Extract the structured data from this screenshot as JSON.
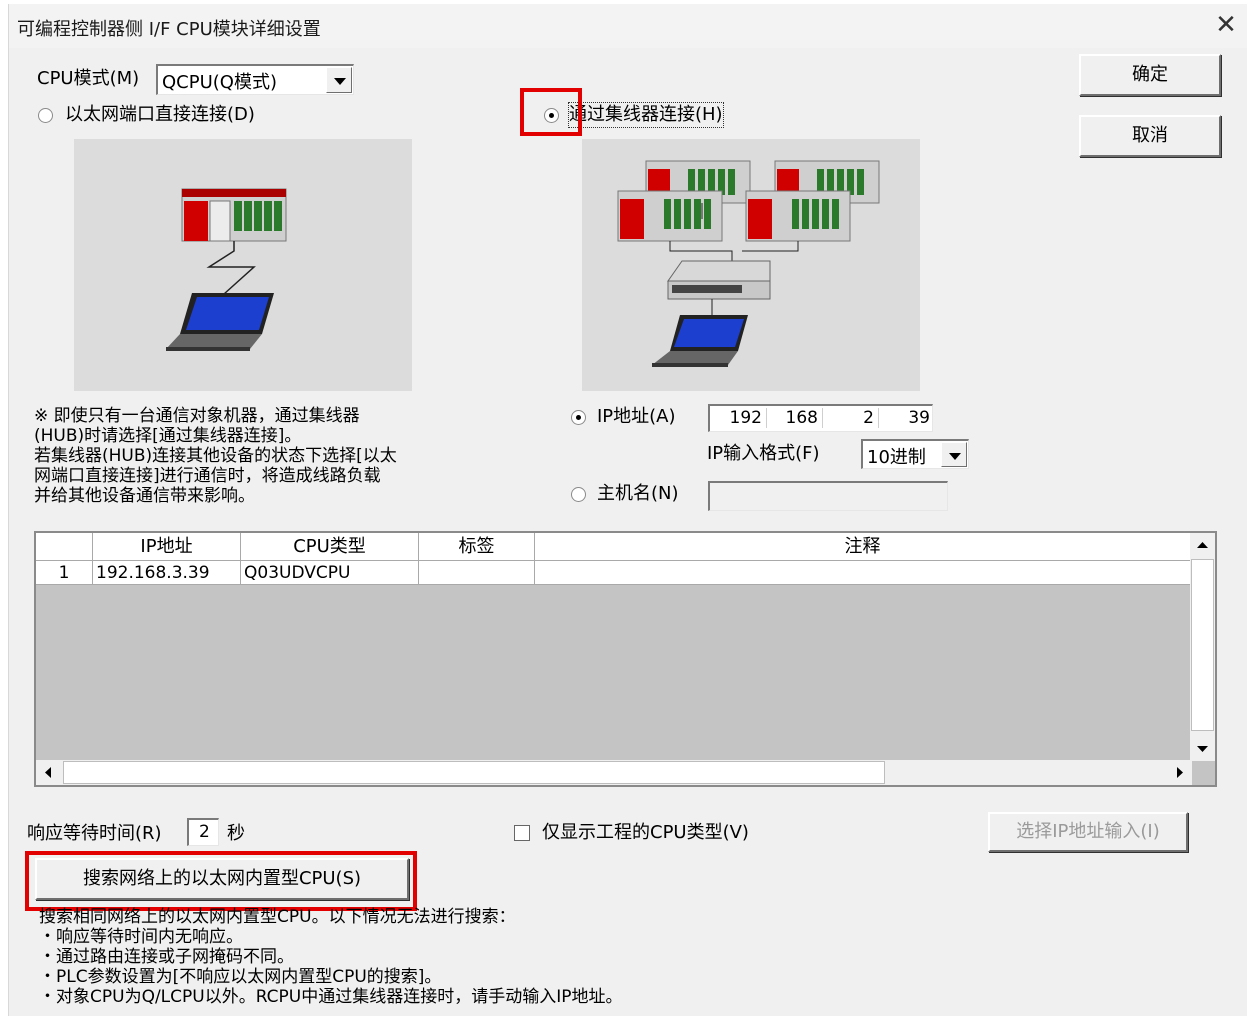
{
  "window": {
    "title": "可编程控制器侧 I/F CPU模块详细设置",
    "close_glyph": "✕"
  },
  "cpu_mode": {
    "label": "CPU模式(M)",
    "value": "QCPU(Q模式)"
  },
  "connection": {
    "direct_label": "以太网端口直接连接(D)",
    "hub_label": "通过集线器连接(H)",
    "selected": "hub"
  },
  "buttons": {
    "ok": "确定",
    "cancel": "取消"
  },
  "note_lines": [
    "※ 即使只有一台通信对象机器，通过集线器",
    "(HUB)时请选择[通过集线器连接]。",
    "若集线器(HUB)连接其他设备的状态下选择[以太",
    "网端口直接连接]进行通信时，将造成线路负载",
    "并给其他设备通信带来影响。"
  ],
  "ip": {
    "radio_label": "IP地址(A)",
    "octets": [
      "192",
      "168",
      "2",
      "39"
    ],
    "format_label": "IP输入格式(F)",
    "format_value": "10进制",
    "hostname_label": "主机名(N)",
    "hostname_value": ""
  },
  "table": {
    "columns": [
      "",
      "IP地址",
      "CPU类型",
      "标签",
      "注释"
    ],
    "rows": [
      [
        "1",
        "192.168.3.39",
        "Q03UDVCPU",
        "",
        ""
      ]
    ]
  },
  "response": {
    "label": "响应等待时间(R)",
    "value": "2",
    "unit": "秒"
  },
  "only_project_cpu": {
    "label": "仅显示工程的CPU类型(V)",
    "checked": false
  },
  "select_ip_button": "选择IP地址输入(I)",
  "search_button": "搜索网络上的以太网内置型CPU(S)",
  "search_info": [
    "搜索相同网络上的以太网内置型CPU。以下情况无法进行搜索：",
    "・响应等待时间内无响应。",
    "・通过路由连接或子网掩码不同。",
    "・PLC参数设置为[不响应以太网内置型CPU的搜索]。",
    "・对象CPU为Q/LCPU以外。RCPU中通过集线器连接时，请手动输入IP地址。"
  ],
  "colors": {
    "highlight": "#e30000",
    "dialog_bg": "#f0f0f0"
  }
}
